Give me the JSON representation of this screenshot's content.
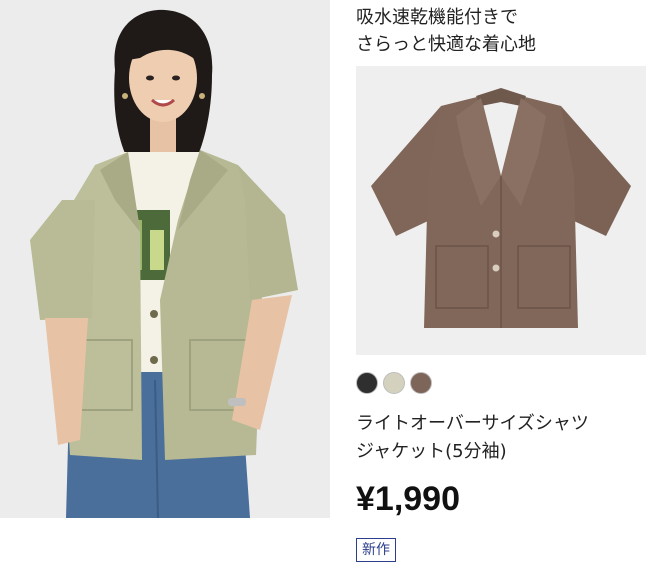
{
  "tagline": {
    "line1": "吸水速乾機能付きで",
    "line2": "さらっと快適な着心地"
  },
  "swatches": [
    {
      "name": "black",
      "color": "#2f2f2f"
    },
    {
      "name": "light-olive",
      "color": "#d4d2bf"
    },
    {
      "name": "brown",
      "color": "#7d6559"
    }
  ],
  "product": {
    "name_line1": "ライトオーバーサイズシャツ",
    "name_line2": "ジャケット(5分袖)",
    "price": "¥1,990",
    "badge": "新作"
  }
}
